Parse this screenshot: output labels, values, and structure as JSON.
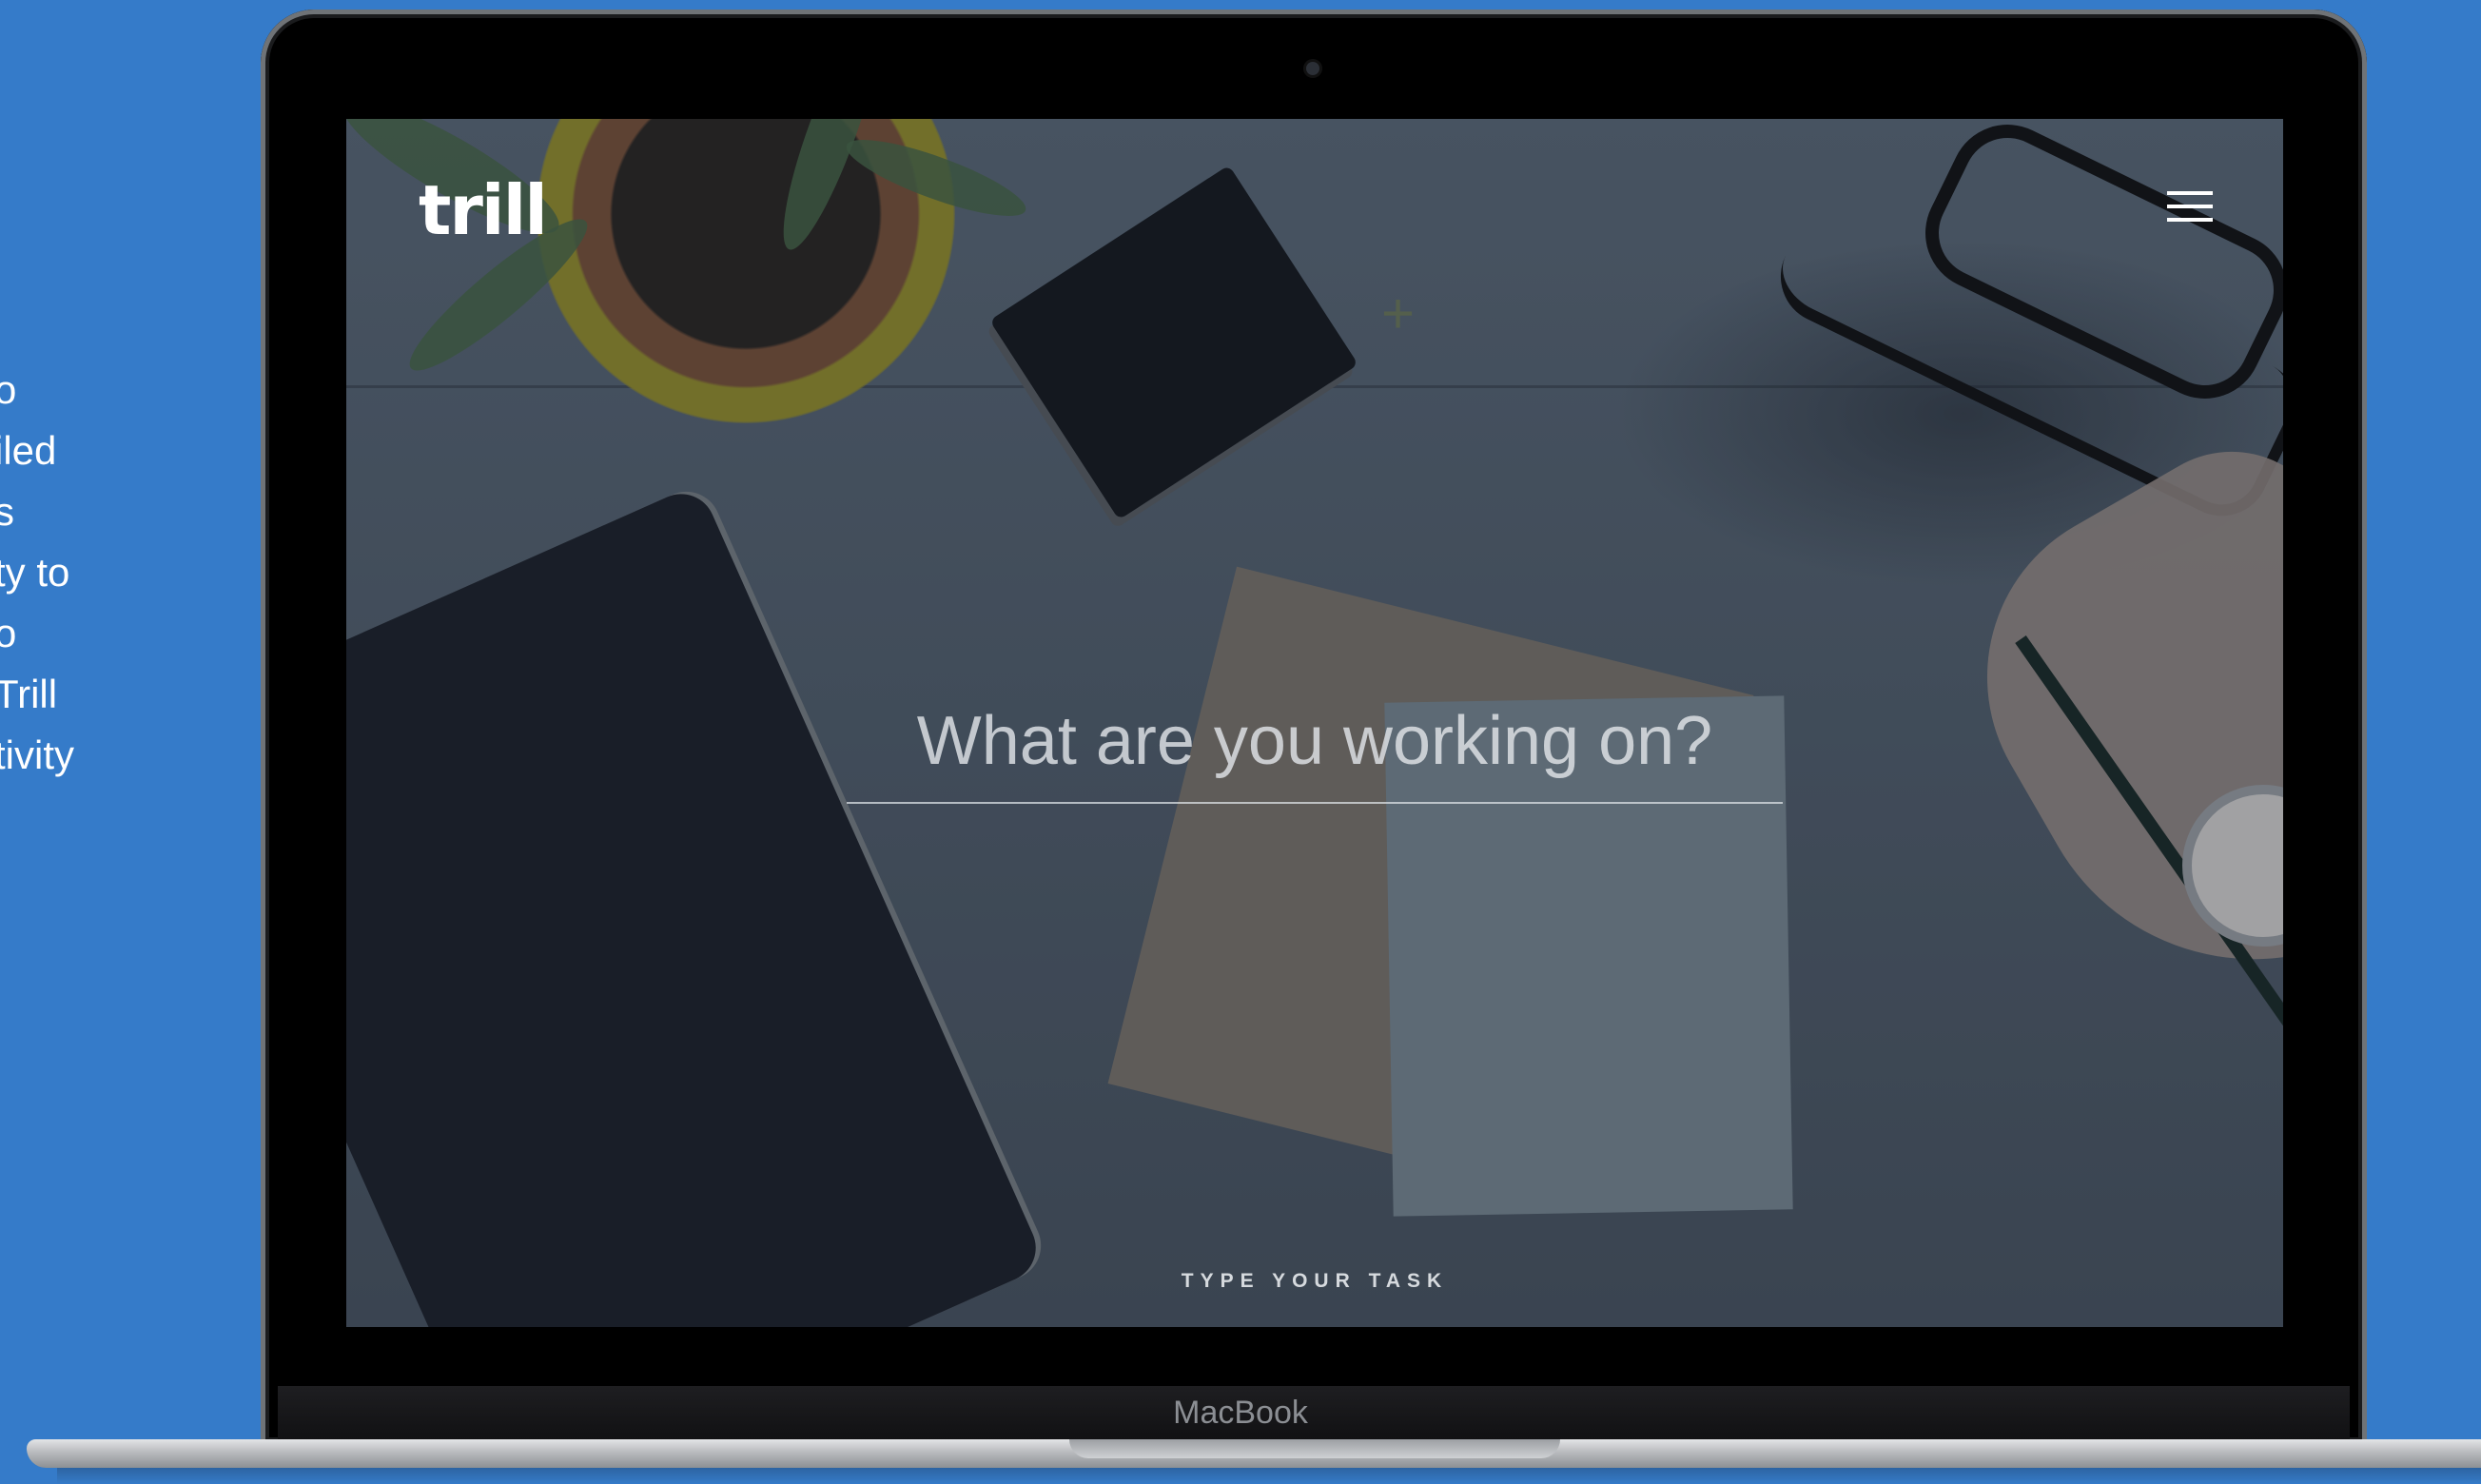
{
  "side_text": {
    "lines": [
      "o",
      "iled",
      "s",
      "ty to",
      "o",
      " Trill",
      "tivity"
    ]
  },
  "device": {
    "brand": "MacBook"
  },
  "app": {
    "logo": "trill",
    "menu_icon": "hamburger-icon",
    "task_input": {
      "placeholder": "What are you working on?",
      "value": ""
    },
    "hint": "TYPE YOUR TASK"
  },
  "colors": {
    "page_background": "#357bc9",
    "text_on_screen": "#ffffff"
  }
}
